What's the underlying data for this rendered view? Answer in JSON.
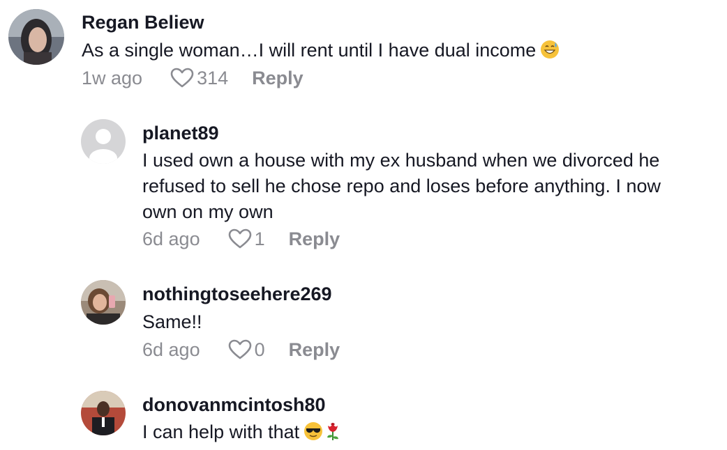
{
  "comments": [
    {
      "username": "Regan Beliew",
      "lines": [
        "As a single woman…I will rent until I have dual income"
      ],
      "emoji": "grinning-sweat-emoji",
      "time": "1w ago",
      "likes": "314",
      "reply_label": "Reply"
    },
    {
      "username": "planet89",
      "lines": [
        "I used own a house with my ex husband when we divorced he",
        "refused to sell he chose repo and loses before anything. I now",
        "own on my own"
      ],
      "time": "6d ago",
      "likes": "1",
      "reply_label": "Reply"
    },
    {
      "username": "nothingtoseehere269",
      "lines": [
        "Same!!"
      ],
      "time": "6d ago",
      "likes": "0",
      "reply_label": "Reply"
    },
    {
      "username": "donovanmcintosh80",
      "lines": [
        "I can help with that"
      ],
      "emoji": "sunglasses-rose-emoji"
    }
  ],
  "colors": {
    "text": "#161823",
    "meta": "#8a8b91"
  }
}
